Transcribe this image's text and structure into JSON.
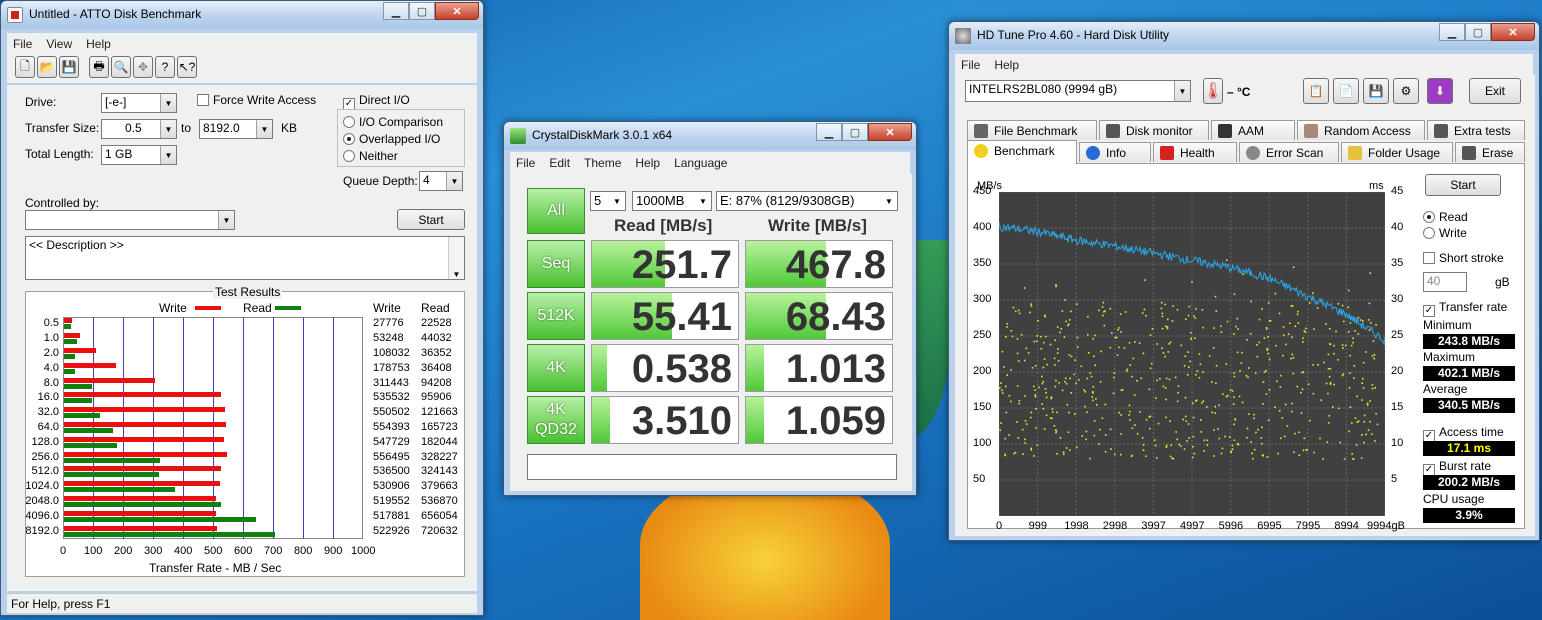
{
  "desktop": {
    "bg": "#1872c0"
  },
  "atto": {
    "title": "Untitled - ATTO Disk Benchmark",
    "menu": [
      "File",
      "View",
      "Help"
    ],
    "drive_label": "Drive:",
    "drive_value": "[-e-]",
    "force_write_label": "Force Write Access",
    "direct_io_label": "Direct I/O",
    "transfer_size_label": "Transfer Size:",
    "transfer_from": "0.5",
    "to_label": "to",
    "transfer_to": "8192.0",
    "kb_label": "KB",
    "total_length_label": "Total Length:",
    "total_length_value": "1 GB",
    "io_comparison": "I/O Comparison",
    "overlapped_io": "Overlapped I/O",
    "neither": "Neither",
    "queue_depth_label": "Queue Depth:",
    "queue_depth_value": "4",
    "controlled_by_label": "Controlled by:",
    "start_label": "Start",
    "description": "<< Description >>",
    "test_results_label": "Test Results",
    "legend_write": "Write",
    "legend_read": "Read",
    "col_write": "Write",
    "col_read": "Read",
    "x_axis_label": "Transfer Rate - MB / Sec",
    "status": "For Help, press F1",
    "write_color": "#e81010",
    "read_color": "#108010"
  },
  "chart_data": {
    "type": "bar",
    "orientation": "horizontal",
    "categories": [
      "0.5",
      "1.0",
      "2.0",
      "4.0",
      "8.0",
      "16.0",
      "32.0",
      "64.0",
      "128.0",
      "256.0",
      "512.0",
      "1024.0",
      "2048.0",
      "4096.0",
      "8192.0"
    ],
    "series": [
      {
        "name": "Write",
        "values": [
          27776,
          53248,
          108032,
          178753,
          311443,
          535532,
          550502,
          554393,
          547729,
          556495,
          536500,
          530906,
          519552,
          517881,
          522926
        ]
      },
      {
        "name": "Read",
        "values": [
          22528,
          44032,
          36352,
          36408,
          94208,
          95906,
          121663,
          165723,
          182044,
          328227,
          324143,
          379663,
          536870,
          656054,
          720632
        ]
      }
    ],
    "x_ticks": [
      "0",
      "100",
      "200",
      "300",
      "400",
      "500",
      "600",
      "700",
      "800",
      "900",
      "1000"
    ],
    "xlabel": "Transfer Rate - MB / Sec",
    "xlim": [
      0,
      1000
    ]
  },
  "cdm": {
    "title": "CrystalDiskMark 3.0.1 x64",
    "menu": [
      "File",
      "Edit",
      "Theme",
      "Help",
      "Language"
    ],
    "all_label": "All",
    "runs": "5",
    "size": "1000MB",
    "drive": "E: 87% (8129/9308GB)",
    "read_header": "Read [MB/s]",
    "write_header": "Write [MB/s]",
    "rows": [
      {
        "label": "Seq",
        "read": "251.7",
        "write": "467.8",
        "read_fill": 0.5,
        "write_fill": 0.55
      },
      {
        "label": "512K",
        "read": "55.41",
        "write": "68.43",
        "read_fill": 0.55,
        "write_fill": 0.55
      },
      {
        "label": "4K",
        "read": "0.538",
        "write": "1.013",
        "read_fill": 0.1,
        "write_fill": 0.12
      },
      {
        "label": "4K\nQD32",
        "read": "3.510",
        "write": "1.059",
        "read_fill": 0.12,
        "write_fill": 0.12
      }
    ]
  },
  "hdtune": {
    "title": "HD Tune Pro 4.60 - Hard Disk Utility",
    "menu": [
      "File",
      "Help"
    ],
    "drive": "INTELRS2BL080 (9994 gB)",
    "temp": "– °C",
    "exit_label": "Exit",
    "tabs_row1": [
      "File Benchmark",
      "Disk monitor",
      "AAM",
      "Random Access",
      "Extra tests"
    ],
    "tabs_row2": [
      "Benchmark",
      "Info",
      "Health",
      "Error Scan",
      "Folder Usage",
      "Erase"
    ],
    "start_label": "Start",
    "read_label": "Read",
    "write_label": "Write",
    "short_stroke_label": "Short stroke",
    "short_stroke_value": "40",
    "gb_label": "gB",
    "transfer_rate_label": "Transfer rate",
    "minimum_label": "Minimum",
    "minimum_value": "243.8 MB/s",
    "maximum_label": "Maximum",
    "maximum_value": "402.1 MB/s",
    "average_label": "Average",
    "average_value": "340.5 MB/s",
    "access_time_label": "Access time",
    "access_time_value": "17.1 ms",
    "burst_rate_label": "Burst rate",
    "burst_rate_value": "200.2 MB/s",
    "cpu_usage_label": "CPU usage",
    "cpu_usage_value": "3.9%",
    "y_unit_left": "MB/s",
    "y_unit_right": "ms",
    "y_left_ticks": [
      "450",
      "400",
      "350",
      "300",
      "250",
      "200",
      "150",
      "100",
      "50"
    ],
    "y_right_ticks": [
      "45",
      "40",
      "35",
      "30",
      "25",
      "20",
      "15",
      "10",
      "5"
    ],
    "x_ticks": [
      "0",
      "999",
      "1998",
      "2998",
      "3997",
      "4997",
      "5996",
      "6995",
      "7995",
      "8994",
      "9994gB"
    ],
    "line_color": "#29a9e8",
    "dot_color": "#e8e830",
    "transfer_curve": [
      [
        0,
        402
      ],
      [
        999,
        395
      ],
      [
        1998,
        383
      ],
      [
        2998,
        375
      ],
      [
        3997,
        365
      ],
      [
        4997,
        355
      ],
      [
        5996,
        345
      ],
      [
        6995,
        330
      ],
      [
        7995,
        305
      ],
      [
        8994,
        280
      ],
      [
        9994,
        244
      ]
    ]
  }
}
